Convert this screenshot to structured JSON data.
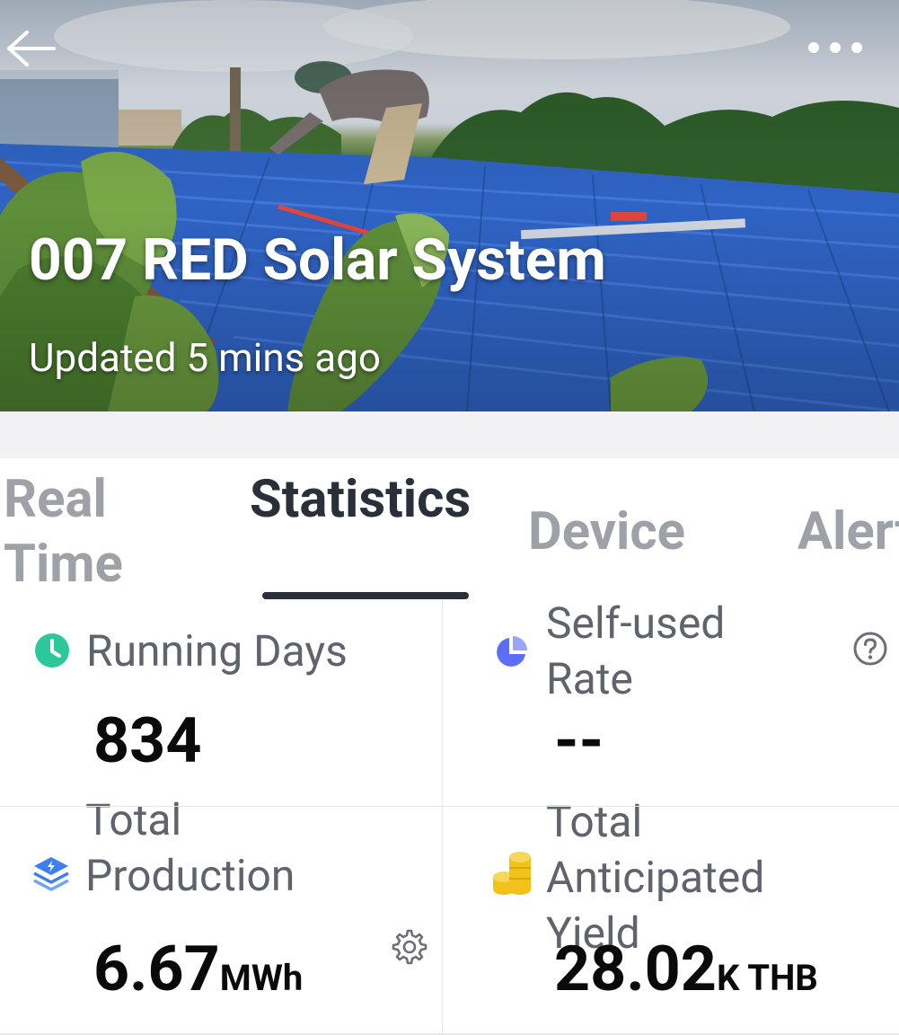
{
  "header": {
    "title": "007 RED Solar System",
    "subtitle": "Updated 5 mins ago",
    "back_icon": "arrow-left-icon",
    "more_icon": "more-horizontal-icon"
  },
  "tabs": [
    {
      "label": "Real Time",
      "active": false
    },
    {
      "label": "Statistics",
      "active": true
    },
    {
      "label": "Device",
      "active": false
    },
    {
      "label": "Alert",
      "active": false
    }
  ],
  "stats": {
    "running_days": {
      "label": "Running Days",
      "value": "834",
      "icon": "clock-icon",
      "color": "#2cc79b"
    },
    "self_used_rate": {
      "label": "Self-used Rate",
      "value": "--",
      "icon": "pie-chart-icon",
      "color": "#5b6ef5",
      "help_icon": "question-circle-icon"
    },
    "total_production": {
      "label": "Total Production",
      "value": "6.67",
      "unit": "MWh",
      "icon": "layers-bolt-icon",
      "color": "#3d7ef0",
      "settings_icon": "gear-icon"
    },
    "total_yield": {
      "label": "Total Anticipated Yield",
      "value": "28.02",
      "unit": "K THB",
      "icon": "coins-icon",
      "color": "#f2c21b"
    }
  },
  "colors": {
    "tab_active": "#2b2f3a",
    "tab_inactive": "#9ea1a8",
    "label": "#5f636b",
    "roof": "#2f63c4"
  }
}
